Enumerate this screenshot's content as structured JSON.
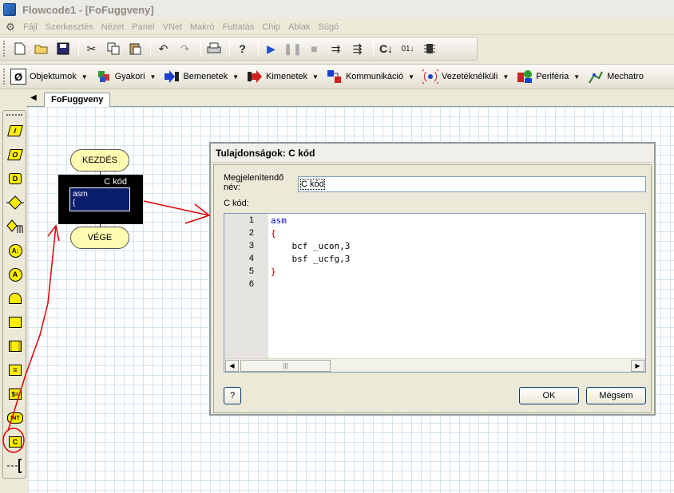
{
  "window": {
    "title": "Flowcode1 - [FoFuggveny]"
  },
  "menu": [
    "Fájl",
    "Szerkesztés",
    "Nézet",
    "Panel",
    "VNet",
    "Makró",
    "Futtatás",
    "Chip",
    "Ablak",
    "Súgó"
  ],
  "toolbar_icons": [
    "new-file-icon",
    "open-folder-icon",
    "save-icon",
    "cut-icon",
    "copy-icon",
    "paste-icon",
    "undo-icon",
    "redo-icon",
    "print-icon",
    "help-icon",
    "run-icon",
    "pause-icon",
    "stop-icon",
    "step-into-icon",
    "step-over-icon",
    "compile-c-icon",
    "compile-chip-icon",
    "chip-icon"
  ],
  "component_toolbar": [
    {
      "label": "Objektumok",
      "icon": "objects-icon"
    },
    {
      "label": "Gyakori",
      "icon": "common-icon"
    },
    {
      "label": "Bemenetek",
      "icon": "inputs-icon"
    },
    {
      "label": "Kimenetek",
      "icon": "outputs-icon"
    },
    {
      "label": "Kommunikáció",
      "icon": "communication-icon"
    },
    {
      "label": "Vezetéknélküli",
      "icon": "wireless-icon"
    },
    {
      "label": "Periféria",
      "icon": "peripheral-icon"
    },
    {
      "label": "Mechatro",
      "icon": "mechatronics-icon"
    }
  ],
  "icon_palette": [
    {
      "name": "input-icon",
      "glyph": "I"
    },
    {
      "name": "output-icon",
      "glyph": "O"
    },
    {
      "name": "delay-icon",
      "glyph": "D"
    },
    {
      "name": "decision-icon",
      "glyph": ""
    },
    {
      "name": "switch-icon",
      "glyph": ""
    },
    {
      "name": "connection-point-icon",
      "glyph": "A:"
    },
    {
      "name": "goto-icon",
      "glyph": "A"
    },
    {
      "name": "loop-icon",
      "glyph": ""
    },
    {
      "name": "macro-icon",
      "glyph": ""
    },
    {
      "name": "component-macro-icon",
      "glyph": ""
    },
    {
      "name": "calculation-icon",
      "glyph": "="
    },
    {
      "name": "string-icon",
      "glyph": "$="
    },
    {
      "name": "interrupt-icon",
      "glyph": "INT"
    },
    {
      "name": "c-code-icon",
      "glyph": "C"
    },
    {
      "name": "comment-icon",
      "glyph": ""
    }
  ],
  "tab": {
    "label": "FoFuggveny"
  },
  "flowchart": {
    "start_label": "KEZDÉS",
    "end_label": "VÉGE",
    "c_block_title": "C kód",
    "c_block_lines": [
      "asm",
      "{"
    ]
  },
  "dialog": {
    "title": "Tulajdonságok: C kód",
    "display_name_label": "Megjelenítendő név:",
    "display_name_value": "C kód",
    "code_label": "C kód:",
    "line_numbers": [
      "1",
      "2",
      "3",
      "4",
      "5",
      "6"
    ],
    "code_lines": [
      "asm",
      "{",
      "    bcf _ucon,3",
      "    bsf _ucfg,3",
      "}",
      ""
    ],
    "help_button": "?",
    "ok_button": "OK",
    "cancel_button": "Mégsem"
  },
  "colors": {
    "keyword": "#0000c0",
    "brace": "#c00000",
    "flow_yellow": "#ffee00",
    "annotation_red": "#e00000"
  }
}
